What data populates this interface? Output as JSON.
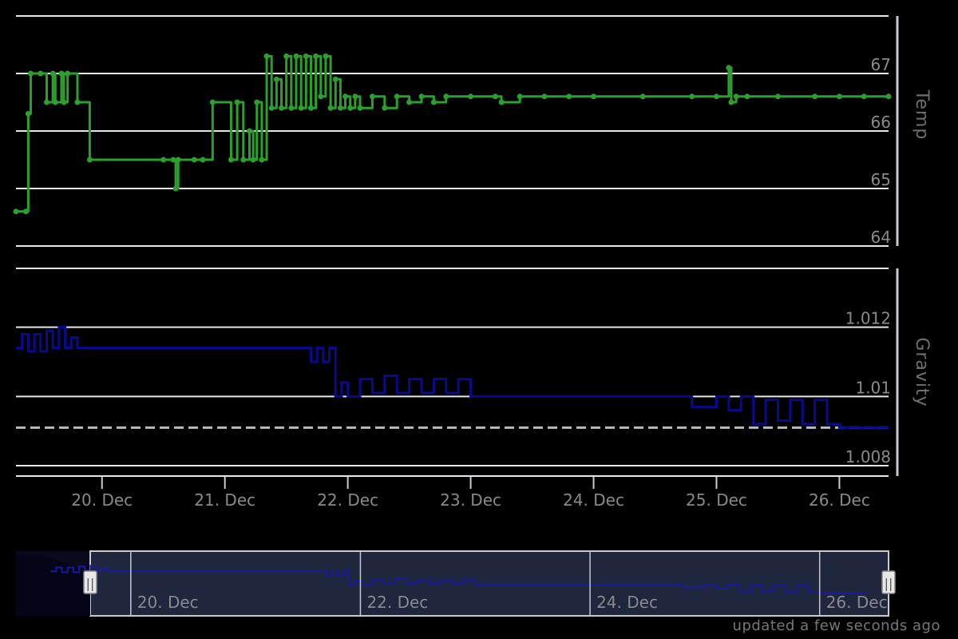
{
  "status_text": "updated a few seconds ago",
  "chart_data": [
    {
      "type": "line",
      "id": "temp",
      "ylabel": "Temp",
      "ylim": [
        64,
        68
      ],
      "yticks": [
        64,
        65,
        66,
        67
      ],
      "color": "#2ca02c",
      "markers": true,
      "series": [
        {
          "x": [
            19.3,
            19.38,
            19.4,
            19.42,
            19.5,
            19.55,
            19.6,
            19.62,
            19.67,
            19.69,
            19.72,
            19.8,
            19.9,
            20.5,
            20.58,
            20.6,
            20.62,
            20.75,
            20.82,
            20.9,
            21.05,
            21.1,
            21.15,
            21.2,
            21.23,
            21.26,
            21.3,
            21.34,
            21.38,
            21.42,
            21.46,
            21.5,
            21.54,
            21.58,
            21.62,
            21.66,
            21.7,
            21.74,
            21.78,
            21.82,
            21.86,
            21.9,
            21.94,
            21.98,
            22.02,
            22.06,
            22.1,
            22.2,
            22.3,
            22.4,
            22.5,
            22.6,
            22.7,
            22.8,
            23.0,
            23.2,
            23.25,
            23.4,
            23.6,
            23.8,
            24.0,
            24.4,
            24.8,
            25.0,
            25.1,
            25.12,
            25.16,
            25.25,
            25.5,
            25.8,
            26.0,
            26.2,
            26.4
          ],
          "values": [
            64.6,
            64.6,
            66.3,
            67.0,
            67.0,
            66.5,
            67.0,
            66.5,
            67.0,
            66.5,
            67.0,
            66.5,
            65.5,
            65.5,
            65.5,
            65.0,
            65.5,
            65.5,
            65.5,
            66.5,
            65.5,
            66.5,
            65.5,
            66.0,
            65.5,
            66.5,
            65.5,
            67.3,
            66.4,
            66.9,
            66.4,
            67.3,
            66.4,
            67.3,
            66.4,
            67.3,
            66.4,
            67.3,
            66.6,
            67.3,
            66.4,
            66.9,
            66.4,
            66.6,
            66.4,
            66.6,
            66.4,
            66.6,
            66.4,
            66.6,
            66.5,
            66.6,
            66.5,
            66.6,
            66.6,
            66.6,
            66.5,
            66.6,
            66.6,
            66.6,
            66.6,
            66.6,
            66.6,
            66.6,
            67.1,
            66.5,
            66.6,
            66.6,
            66.6,
            66.6,
            66.6,
            66.6,
            66.6
          ]
        }
      ]
    },
    {
      "type": "line",
      "id": "gravity",
      "ylabel": "Gravity",
      "ylim": [
        1.0077,
        1.0137
      ],
      "yticks": [
        1.008,
        1.01,
        1.012
      ],
      "color": "#0a0a8c",
      "reference_line": 1.0091,
      "series": [
        {
          "x": [
            19.3,
            19.35,
            19.4,
            19.45,
            19.5,
            19.55,
            19.6,
            19.65,
            19.7,
            19.75,
            19.8,
            19.9,
            20.0,
            20.1,
            20.2,
            20.4,
            20.6,
            20.8,
            21.0,
            21.2,
            21.4,
            21.6,
            21.7,
            21.75,
            21.8,
            21.85,
            21.9,
            21.95,
            22.0,
            22.1,
            22.2,
            22.3,
            22.4,
            22.5,
            22.6,
            22.7,
            22.8,
            22.9,
            23.0,
            23.1,
            23.2,
            23.4,
            23.6,
            23.8,
            24.0,
            24.2,
            24.4,
            24.6,
            24.8,
            25.0,
            25.1,
            25.2,
            25.3,
            25.4,
            25.5,
            25.6,
            25.7,
            25.8,
            25.9,
            26.0,
            26.2,
            26.4
          ],
          "values": [
            1.0114,
            1.0118,
            1.0113,
            1.0118,
            1.0113,
            1.0119,
            1.0114,
            1.012,
            1.0114,
            1.0117,
            1.0114,
            1.0114,
            1.0114,
            1.0114,
            1.0114,
            1.0114,
            1.0114,
            1.0114,
            1.0114,
            1.0114,
            1.0114,
            1.0114,
            1.011,
            1.0114,
            1.011,
            1.0114,
            1.01,
            1.0104,
            1.01,
            1.0105,
            1.0101,
            1.0106,
            1.0101,
            1.0105,
            1.0101,
            1.0105,
            1.0101,
            1.0105,
            1.01,
            1.01,
            1.01,
            1.01,
            1.01,
            1.01,
            1.01,
            1.01,
            1.01,
            1.01,
            1.0097,
            1.01,
            1.0096,
            1.01,
            1.0092,
            1.0099,
            1.0093,
            1.0099,
            1.0092,
            1.0099,
            1.0092,
            1.0091,
            1.0091,
            1.0091
          ]
        }
      ]
    },
    {
      "type": "area",
      "id": "navigator",
      "role": "range-navigator",
      "xticks": [
        20,
        22,
        24,
        26
      ],
      "xtick_labels": [
        "20. Dec",
        "22. Dec",
        "24. Dec",
        "26. Dec"
      ],
      "selected_range": [
        19.3,
        26.4
      ],
      "handles": [
        "||",
        "||"
      ]
    }
  ],
  "x_axis": {
    "type": "date",
    "ticks": [
      20,
      21,
      22,
      23,
      24,
      25,
      26
    ],
    "tick_labels": [
      "20. Dec",
      "21. Dec",
      "22. Dec",
      "23. Dec",
      "24. Dec",
      "25. Dec",
      "26. Dec"
    ],
    "range": [
      19.3,
      26.4
    ]
  }
}
